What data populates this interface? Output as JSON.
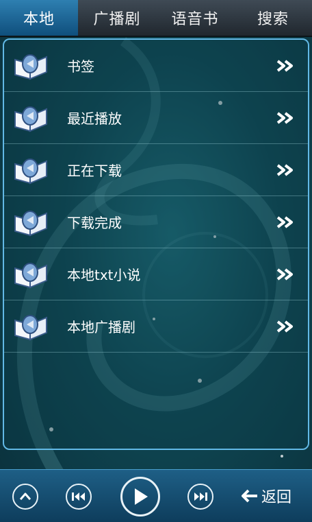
{
  "tabs": [
    {
      "label": "本地",
      "active": true
    },
    {
      "label": "广播剧",
      "active": false
    },
    {
      "label": "语音书",
      "active": false
    },
    {
      "label": "搜索",
      "active": false
    }
  ],
  "menu": {
    "items": [
      {
        "label": "书签",
        "icon": "audio-book-icon"
      },
      {
        "label": "最近播放",
        "icon": "audio-book-icon"
      },
      {
        "label": "正在下载",
        "icon": "audio-book-icon"
      },
      {
        "label": "下载完成",
        "icon": "audio-book-icon"
      },
      {
        "label": "本地txt小说",
        "icon": "audio-book-icon"
      },
      {
        "label": "本地广播剧",
        "icon": "audio-book-icon"
      }
    ],
    "arrow_icon": "double-chevron-right-icon"
  },
  "player": {
    "controls": [
      "up-icon",
      "previous-track-icon",
      "play-icon",
      "next-track-icon"
    ],
    "back_label": "返回",
    "back_icon": "arrow-left-icon"
  },
  "colors": {
    "tab_active": "#1f6fa3",
    "tab_bar": "#2b333b",
    "panel_border": "#62b9e6",
    "background": "#0f4652",
    "player_bar": "#164e72"
  }
}
